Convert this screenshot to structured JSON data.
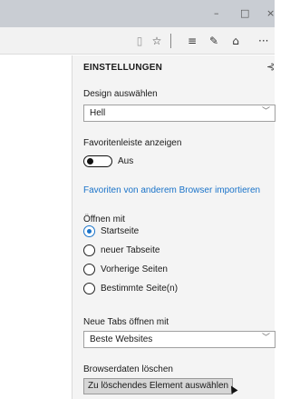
{
  "window": {
    "minimize_glyph": "–",
    "maximize_glyph": "□",
    "close_glyph": "×"
  },
  "toolbar": {
    "icons": {
      "reading_view": "reading-view-icon",
      "favorites": "star-icon",
      "hub": "hub-icon",
      "web_note": "web-note-icon",
      "share": "share-icon",
      "more": "more-icon"
    },
    "reading_view_glyph": "▯",
    "favorites_glyph": "☆",
    "hub_glyph": "≡",
    "web_note_glyph": "✎",
    "share_glyph": "⌂",
    "more_glyph": "···"
  },
  "settings": {
    "title": "EINSTELLUNGEN",
    "pin_glyph": "⊰",
    "design": {
      "label": "Design auswählen",
      "value": "Hell"
    },
    "favorites_bar": {
      "label": "Favoritenleiste anzeigen",
      "state": "Aus"
    },
    "import_link": "Favoriten von anderem Browser importieren",
    "open_with": {
      "label": "Öffnen mit",
      "options": [
        "Startseite",
        "neuer Tabseite",
        "Vorherige Seiten",
        "Bestimmte Seite(n)"
      ],
      "selected": "Startseite"
    },
    "new_tabs": {
      "label": "Neue Tabs öffnen mit",
      "value": "Beste Websites"
    },
    "clear_data": {
      "label": "Browserdaten löschen",
      "button": "Zu löschendes Element auswählen"
    }
  },
  "colors": {
    "accent": "#1a73c9",
    "titlebar": "#c9cdd3",
    "panel_bg": "#f4f4f4"
  }
}
